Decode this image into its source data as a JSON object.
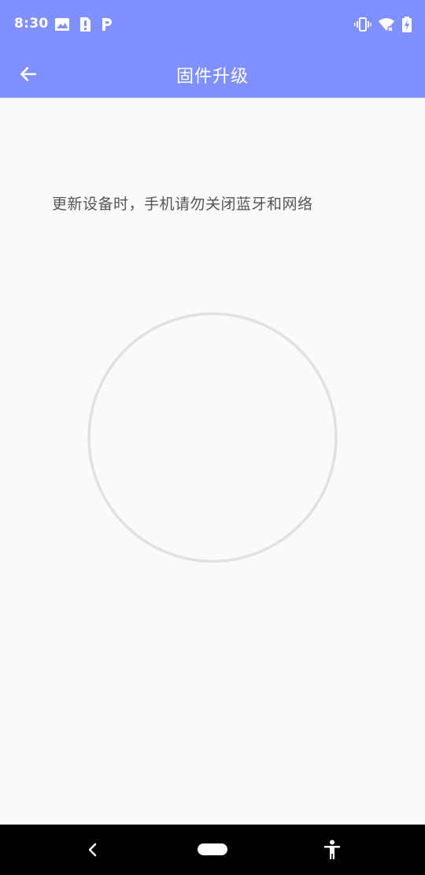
{
  "status_bar": {
    "time": "8:30",
    "left_icons": [
      "image-icon",
      "sim-alert-icon",
      "parking-app-icon"
    ],
    "right_icons": [
      "vibrate-icon",
      "wifi-off-icon",
      "battery-charging-icon"
    ]
  },
  "app_bar": {
    "title": "固件升级",
    "back_icon": "arrow-left-icon"
  },
  "main": {
    "notice": "更新设备时，手机请勿关闭蓝牙和网络"
  },
  "nav_bar": {
    "icons": [
      "nav-back-icon",
      "nav-home-pill",
      "accessibility-icon"
    ]
  },
  "colors": {
    "primary": "#8090ff",
    "background": "#fafafa",
    "ring": "#e2e0e0",
    "notice_text": "#555555"
  }
}
